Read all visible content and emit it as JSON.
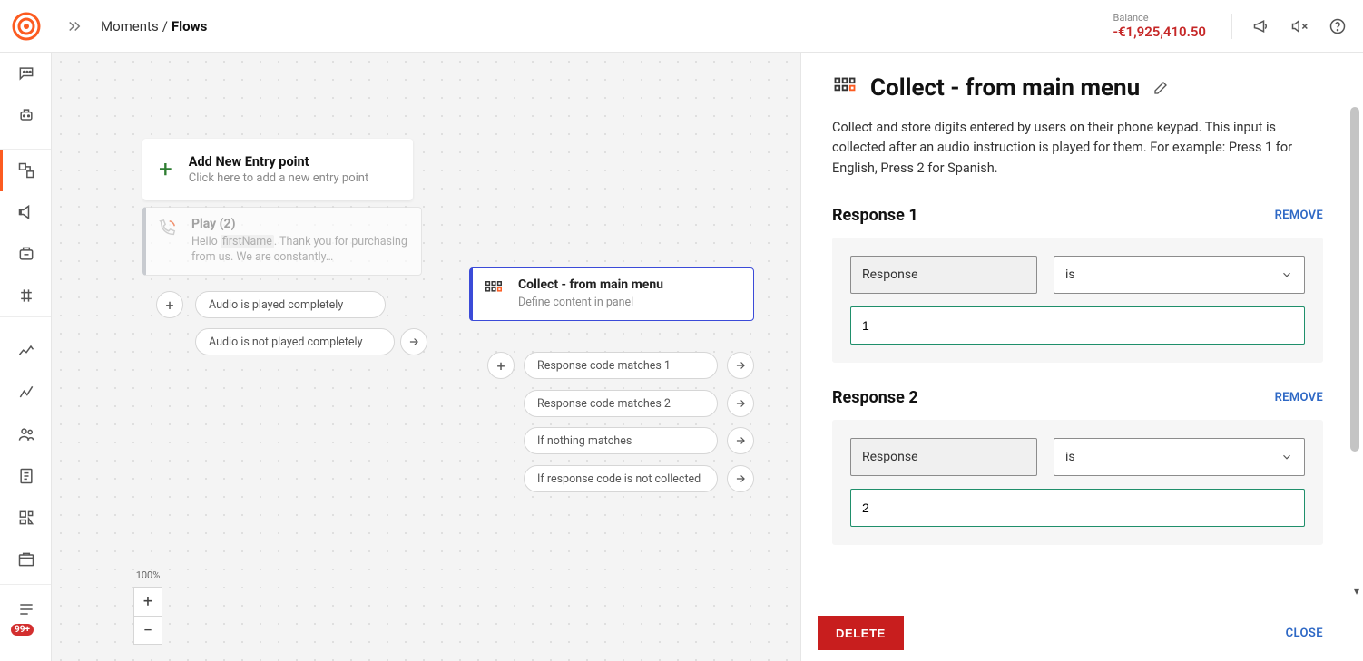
{
  "breadcrumb": {
    "root": "Moments",
    "current": "Flows"
  },
  "balance": {
    "label": "Balance",
    "amount": "-€1,925,410.50"
  },
  "sidebar": {
    "notification_badge": "99+"
  },
  "entry": {
    "title": "Add New Entry point",
    "subtitle": "Click here to add a new entry point"
  },
  "play_node": {
    "title": "Play (2)",
    "sub_prefix": "Hello ",
    "sub_placeholder": "firstName",
    "sub_suffix": ". Thank you for purchasing from us. We are constantly…"
  },
  "play_branches": {
    "complete": "Audio is played completely",
    "incomplete": "Audio is not played completely"
  },
  "collect_node": {
    "title": "Collect - from main menu",
    "sub": "Define content in panel"
  },
  "collect_branches": {
    "b1": "Response code matches 1",
    "b2": "Response code matches 2",
    "b3": "If nothing matches",
    "b4": "If response code is not collected"
  },
  "zoom": {
    "percent": "100%"
  },
  "panel": {
    "title": "Collect - from main menu",
    "description": "Collect and store digits entered by users on their phone keypad. This input is collected after an audio instruction is played for them. For example: Press 1 for English, Press 2 for Spanish.",
    "responses": [
      {
        "heading": "Response 1",
        "field_label": "Response",
        "operator": "is",
        "value": "1"
      },
      {
        "heading": "Response 2",
        "field_label": "Response",
        "operator": "is",
        "value": "2"
      }
    ],
    "remove_label": "REMOVE",
    "delete_label": "DELETE",
    "close_label": "CLOSE"
  }
}
